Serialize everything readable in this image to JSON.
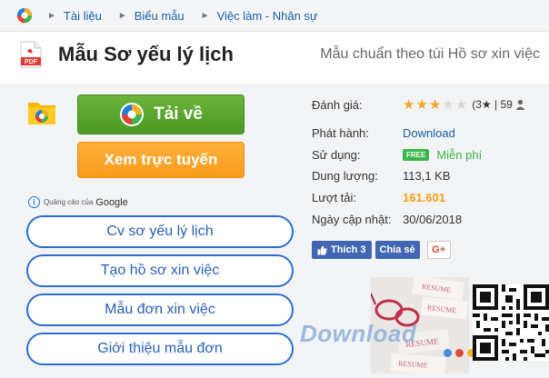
{
  "breadcrumb": {
    "items": [
      "Tài liệu",
      "Biểu mẫu",
      "Việc làm - Nhân sự"
    ]
  },
  "page": {
    "title": "Mẫu Sơ yếu lý lịch",
    "subtitle": "Mẫu chuẩn theo túi Hồ sơ xin việc"
  },
  "actions": {
    "download_label": "Tải về",
    "online_label": "Xem trực tuyến"
  },
  "ads": {
    "label": "Quảng cáo của",
    "brand": "Google",
    "items": [
      "Cv sơ yếu lý lịch",
      "Tạo hồ sơ xin việc",
      "Mẫu đơn xin việc",
      "Giới thiệu mẫu đơn"
    ]
  },
  "info": {
    "rating_label": "Đánh giá:",
    "rating_stars": 3,
    "rating_text": "(3★ | 59",
    "publisher_label": "Phát hành:",
    "publisher_value": "Download",
    "usage_label": "Sử dụng:",
    "usage_badge": "FREE",
    "usage_value": "Miễn phí",
    "size_label": "Dung lượng:",
    "size_value": "113,1 KB",
    "downloads_label": "Lượt tải:",
    "downloads_value": "161.601",
    "updated_label": "Ngày cập nhật:",
    "updated_value": "30/06/2018"
  },
  "social": {
    "like_label": "Thích 3",
    "share_label": "Chia sẻ",
    "gplus_label": "G+"
  },
  "watermark": "Download",
  "colors": {
    "link": "#1a5fa8",
    "download_green": "#4b9a24",
    "online_orange": "#f99c1c",
    "accent_orange": "#f5a010",
    "free_green": "#3db54a",
    "facebook": "#4267b2"
  },
  "icons": [
    "home-logo-icon",
    "pdf-file-icon",
    "folder-app-icon",
    "download-logo-icon",
    "info-icon",
    "star-icon",
    "user-icon",
    "qr-code-icon"
  ]
}
